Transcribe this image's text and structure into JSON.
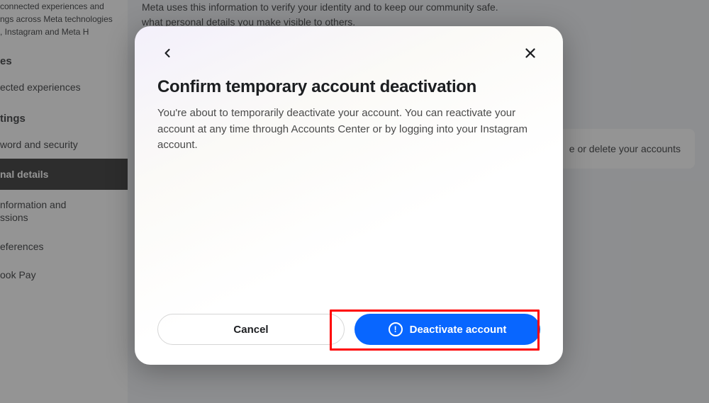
{
  "sidebar": {
    "intro_line1": "connected experiences and",
    "intro_line2": "ngs across Meta technologies",
    "intro_line3": ", Instagram and Meta H",
    "group1_title": "es",
    "group1_item": "ected experiences",
    "group2_title": "tings",
    "items": [
      "word and security",
      "nal details",
      "nformation and\nssions",
      "eferences",
      "ook Pay"
    ]
  },
  "main": {
    "desc_line1": "Meta uses this information to verify your identity and to keep our community safe.",
    "desc_line2": "what personal details you make visible to others.",
    "panel_text": "e or delete your accounts"
  },
  "modal": {
    "title": "Confirm temporary account deactivation",
    "body": "You're about to temporarily deactivate your account. You can reactivate your account at any time through Accounts Center or by logging into your Instagram account.",
    "cancel_label": "Cancel",
    "confirm_label": "Deactivate account"
  }
}
